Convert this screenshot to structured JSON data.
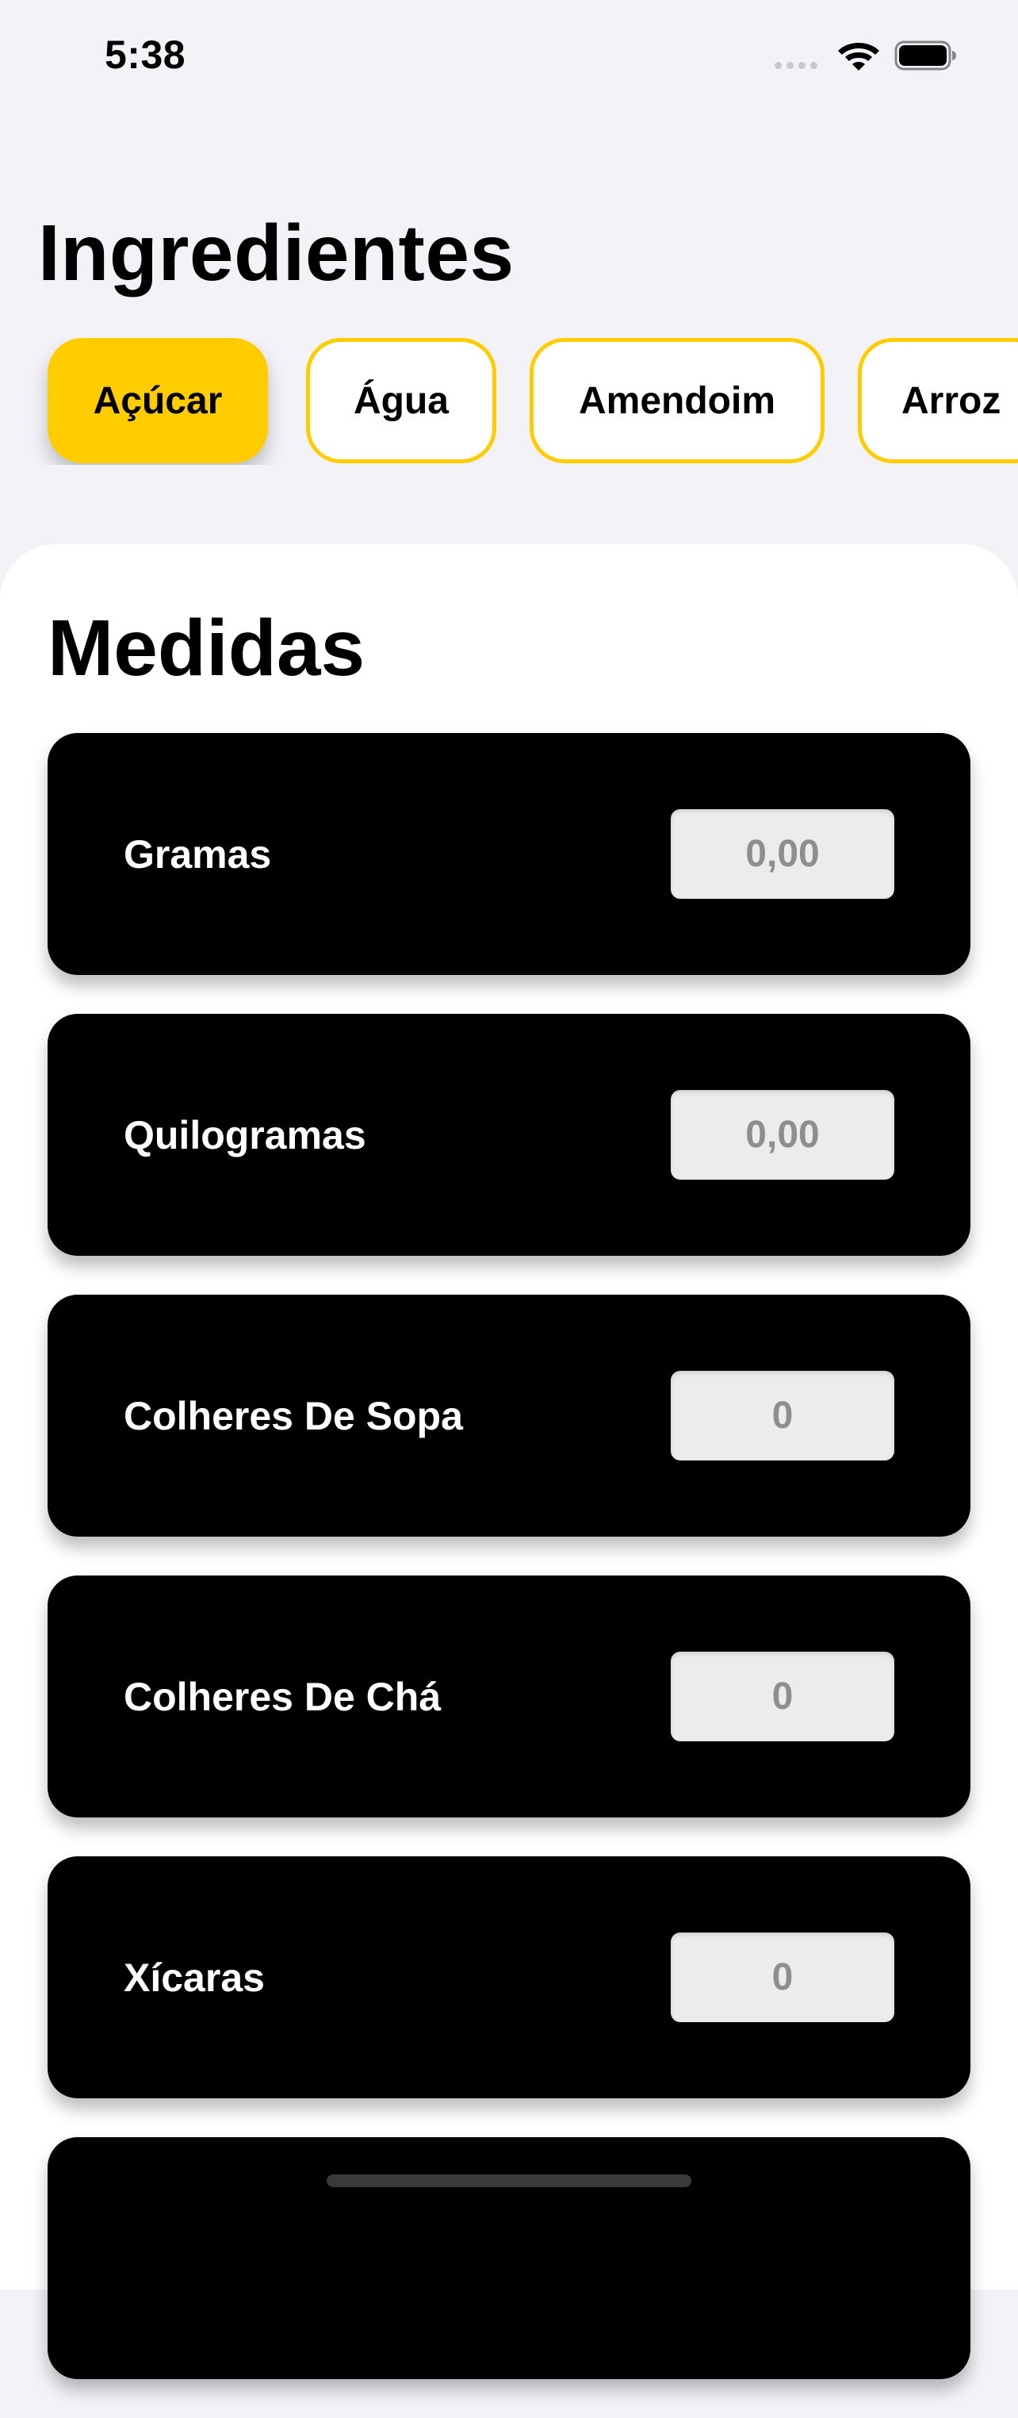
{
  "status_bar": {
    "time": "5:38"
  },
  "header": {
    "title": "Ingredientes"
  },
  "ingredients": [
    {
      "label": "Açúcar",
      "selected": true
    },
    {
      "label": "Água",
      "selected": false
    },
    {
      "label": "Amendoim",
      "selected": false
    },
    {
      "label": "Arroz",
      "selected": false
    }
  ],
  "measures_section": {
    "title": "Medidas"
  },
  "measures": [
    {
      "label": "Gramas",
      "value": "0,00"
    },
    {
      "label": "Quilogramas",
      "value": "0,00"
    },
    {
      "label": "Colheres De Sopa",
      "value": "0"
    },
    {
      "label": "Colheres De Chá",
      "value": "0"
    },
    {
      "label": "Xícaras",
      "value": "0"
    },
    {
      "label": "",
      "value": ""
    }
  ],
  "colors": {
    "accent": "#ffcc00",
    "card": "#000000",
    "background": "#f2f2f7"
  }
}
